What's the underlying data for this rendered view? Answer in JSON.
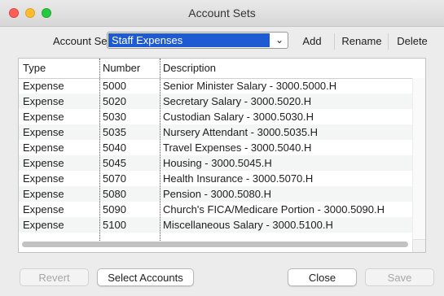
{
  "window": {
    "title": "Account Sets"
  },
  "toolbar": {
    "label": "Account Sets:",
    "selected_set": "Staff Expenses",
    "add_label": "Add",
    "rename_label": "Rename",
    "delete_label": "Delete"
  },
  "table": {
    "columns": [
      "Type",
      "Number",
      "Description"
    ],
    "rows": [
      {
        "type": "Expense",
        "number": "5000",
        "description": "Senior Minister Salary - 3000.5000.H"
      },
      {
        "type": "Expense",
        "number": "5020",
        "description": "Secretary Salary - 3000.5020.H"
      },
      {
        "type": "Expense",
        "number": "5030",
        "description": "Custodian Salary - 3000.5030.H"
      },
      {
        "type": "Expense",
        "number": "5035",
        "description": "Nursery Attendant - 3000.5035.H"
      },
      {
        "type": "Expense",
        "number": "5040",
        "description": "Travel Expenses - 3000.5040.H"
      },
      {
        "type": "Expense",
        "number": "5045",
        "description": "Housing - 3000.5045.H"
      },
      {
        "type": "Expense",
        "number": "5070",
        "description": "Health Insurance - 3000.5070.H"
      },
      {
        "type": "Expense",
        "number": "5080",
        "description": "Pension - 3000.5080.H"
      },
      {
        "type": "Expense",
        "number": "5090",
        "description": "Church's FICA/Medicare Portion - 3000.5090.H"
      },
      {
        "type": "Expense",
        "number": "5100",
        "description": "Miscellaneous Salary - 3000.5100.H"
      }
    ]
  },
  "footer": {
    "revert_label": "Revert",
    "select_accounts_label": "Select Accounts",
    "close_label": "Close",
    "save_label": "Save"
  }
}
